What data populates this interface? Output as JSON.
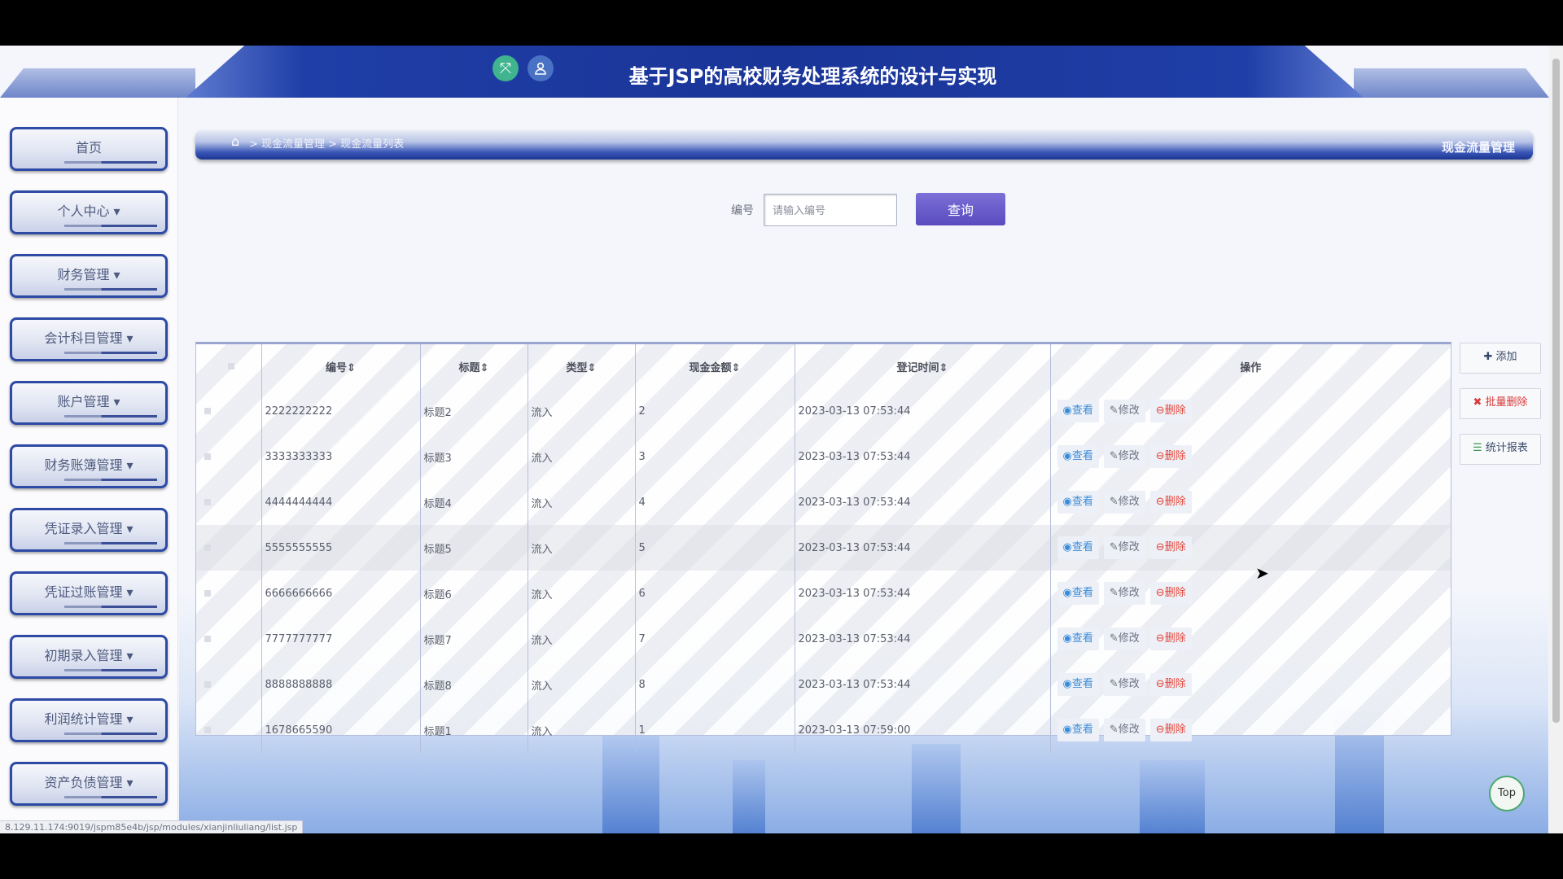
{
  "app_title": "基于JSP的高校财务处理系统的设计与实现",
  "nav": [
    {
      "label": "首页"
    },
    {
      "label": "个人中心 ▾"
    },
    {
      "label": "财务管理 ▾"
    },
    {
      "label": "会计科目管理 ▾"
    },
    {
      "label": "账户管理 ▾"
    },
    {
      "label": "财务账簿管理 ▾"
    },
    {
      "label": "凭证录入管理 ▾"
    },
    {
      "label": "凭证过账管理 ▾"
    },
    {
      "label": "初期录入管理 ▾"
    },
    {
      "label": "利润统计管理 ▾"
    },
    {
      "label": "资产负债管理 ▾"
    }
  ],
  "breadcrumb": {
    "path": "> 现金流量管理 > 现金流量列表",
    "right_title": "现金流量管理"
  },
  "search": {
    "label": "编号",
    "placeholder": "请输入编号",
    "button": "查询"
  },
  "table": {
    "headers": [
      "编号",
      "标题",
      "类型",
      "现金金额",
      "登记时间",
      "操作"
    ],
    "rows": [
      {
        "id": "2222222222",
        "title": "标题2",
        "type": "流入",
        "amount": "2",
        "time": "2023-03-13 07:53:44"
      },
      {
        "id": "3333333333",
        "title": "标题3",
        "type": "流入",
        "amount": "3",
        "time": "2023-03-13 07:53:44"
      },
      {
        "id": "4444444444",
        "title": "标题4",
        "type": "流入",
        "amount": "4",
        "time": "2023-03-13 07:53:44"
      },
      {
        "id": "5555555555",
        "title": "标题5",
        "type": "流入",
        "amount": "5",
        "time": "2023-03-13 07:53:44"
      },
      {
        "id": "6666666666",
        "title": "标题6",
        "type": "流入",
        "amount": "6",
        "time": "2023-03-13 07:53:44"
      },
      {
        "id": "7777777777",
        "title": "标题7",
        "type": "流入",
        "amount": "7",
        "time": "2023-03-13 07:53:44"
      },
      {
        "id": "8888888888",
        "title": "标题8",
        "type": "流入",
        "amount": "8",
        "time": "2023-03-13 07:53:44"
      },
      {
        "id": "1678665590",
        "title": "标题1",
        "type": "流入",
        "amount": "1",
        "time": "2023-03-13 07:59:00"
      }
    ],
    "actions": {
      "view": "查看",
      "edit": "修改",
      "delete": "删除"
    }
  },
  "side_actions": {
    "add": "添加",
    "batch_delete": "批量删除",
    "report": "统计报表"
  },
  "top_button": "Top",
  "status_url": "8.129.11.174:9019/jspm85e4b/jsp/modules/xianjinliuliang/list.jsp",
  "colors": {
    "header_blue": "#1a3598",
    "accent_purple": "#5a4cbf",
    "delete_red": "#e5463b"
  }
}
